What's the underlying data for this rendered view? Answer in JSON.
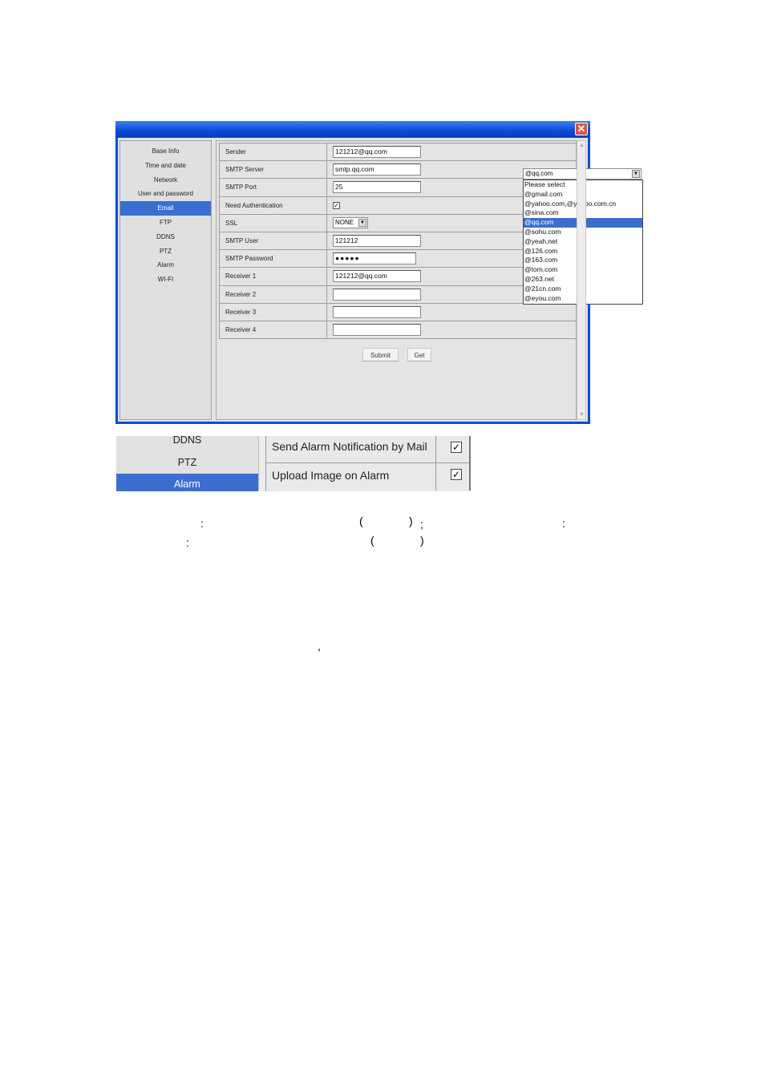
{
  "sidebar": {
    "items": [
      "Base Info",
      "Time and date",
      "Network",
      "User and password",
      "Email",
      "FTP",
      "DDNS",
      "PTZ",
      "Alarm",
      "WI-FI"
    ],
    "active_index": 4
  },
  "form": {
    "rows": [
      {
        "label": "Sender",
        "type": "text",
        "value": "121212@qq.com"
      },
      {
        "label": "SMTP Server",
        "type": "text",
        "value": "smtp.qq.com"
      },
      {
        "label": "SMTP Port",
        "type": "text",
        "value": "25"
      },
      {
        "label": "Need Authentication",
        "type": "checkbox",
        "checked": true
      },
      {
        "label": "SSL",
        "type": "select",
        "value": "NONE"
      },
      {
        "label": "SMTP User",
        "type": "text",
        "value": "121212"
      },
      {
        "label": "SMTP Password",
        "type": "password",
        "value": "●●●●●"
      },
      {
        "label": "Receiver 1",
        "type": "text",
        "value": "121212@qq.com"
      },
      {
        "label": "Receiver 2",
        "type": "text",
        "value": ""
      },
      {
        "label": "Receiver 3",
        "type": "text",
        "value": ""
      },
      {
        "label": "Receiver 4",
        "type": "text",
        "value": ""
      }
    ]
  },
  "smtp_select": {
    "value": "@qq.com",
    "options": [
      "Please select",
      "@gmail.com",
      "@yahoo.com,@yahoo.com.cn",
      "@sina.com",
      "@qq.com",
      "@sohu.com",
      "@yeah.net",
      "@126.com",
      "@163.com",
      "@tom.com",
      "@263.net",
      "@21cn.com",
      "@eyou.com"
    ],
    "selected_index": 4
  },
  "buttons": {
    "submit": "Submit",
    "get": "Get"
  },
  "icons": {
    "close": "close-icon",
    "checkbox": "check-icon",
    "dropdown": "chevron-down-icon"
  },
  "colors": {
    "titlebar": "#0a4bd9",
    "active": "#3a6fd1",
    "close": "#d9553f"
  },
  "zoom": {
    "sidebar_items": [
      "DDNS",
      "PTZ",
      "Alarm"
    ],
    "active_index": 2,
    "rows": [
      {
        "label": "Send Alarm Notification by Mail",
        "checked": true
      },
      {
        "label": "Upload Image on Alarm",
        "checked": true
      }
    ]
  },
  "punctuation": [
    ":",
    "(",
    ")",
    ";",
    ":",
    ":",
    "(",
    ")",
    ","
  ]
}
